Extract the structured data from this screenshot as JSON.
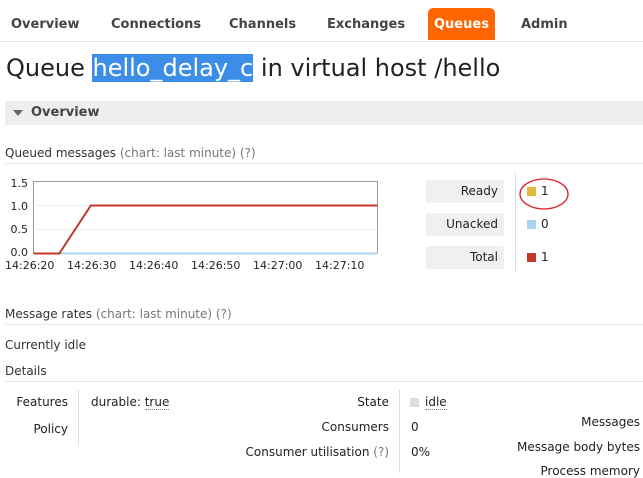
{
  "nav": [
    "Overview",
    "Connections",
    "Channels",
    "Exchanges",
    "Queues",
    "Admin"
  ],
  "title": {
    "prefix": "Queue",
    "queue_name": "hello_delay_c",
    "middle": "in virtual host",
    "vhost": "/hello"
  },
  "section": {
    "label": "Overview"
  },
  "queued": {
    "label": "Queued messages",
    "hint": "(chart: last minute) (?)"
  },
  "chart_data": {
    "type": "line",
    "x": [
      "14:26:20",
      "14:26:30",
      "14:26:40",
      "14:26:50",
      "14:27:00",
      "14:27:10"
    ],
    "ylim": [
      0,
      1.5
    ],
    "yticks": [
      "1.5",
      "1.0",
      "0.5",
      "0.0"
    ],
    "series": [
      {
        "name": "Ready",
        "color": "#c0392b",
        "points": [
          [
            0,
            0
          ],
          [
            0.45,
            0
          ],
          [
            1.0,
            1.0
          ],
          [
            6.0,
            1.0
          ]
        ]
      },
      {
        "name": "Unacked",
        "color": "#a8d4f0",
        "points": [
          [
            0,
            0
          ],
          [
            6.0,
            0
          ]
        ]
      }
    ]
  },
  "counters": [
    {
      "label": "Ready",
      "value": "1",
      "color": "#e2b93b"
    },
    {
      "label": "Unacked",
      "value": "0",
      "color": "#a8d4f0"
    },
    {
      "label": "Total",
      "value": "1",
      "color": "#c0392b"
    }
  ],
  "rates": {
    "label": "Message rates",
    "hint": "(chart: last minute) (?)",
    "status": "Currently idle"
  },
  "details": {
    "label": "Details",
    "features_label": "Features",
    "durable_key": "durable:",
    "durable_value": "true",
    "policy_label": "Policy",
    "state_label": "State",
    "state_value": "idle",
    "consumers_label": "Consumers",
    "consumers_value": "0",
    "util_label": "Consumer utilisation",
    "util_hint": "(?)",
    "util_value": "0%",
    "messages_label": "Messages",
    "body_bytes_label": "Message body bytes",
    "process_memory_label": "Process memory"
  }
}
